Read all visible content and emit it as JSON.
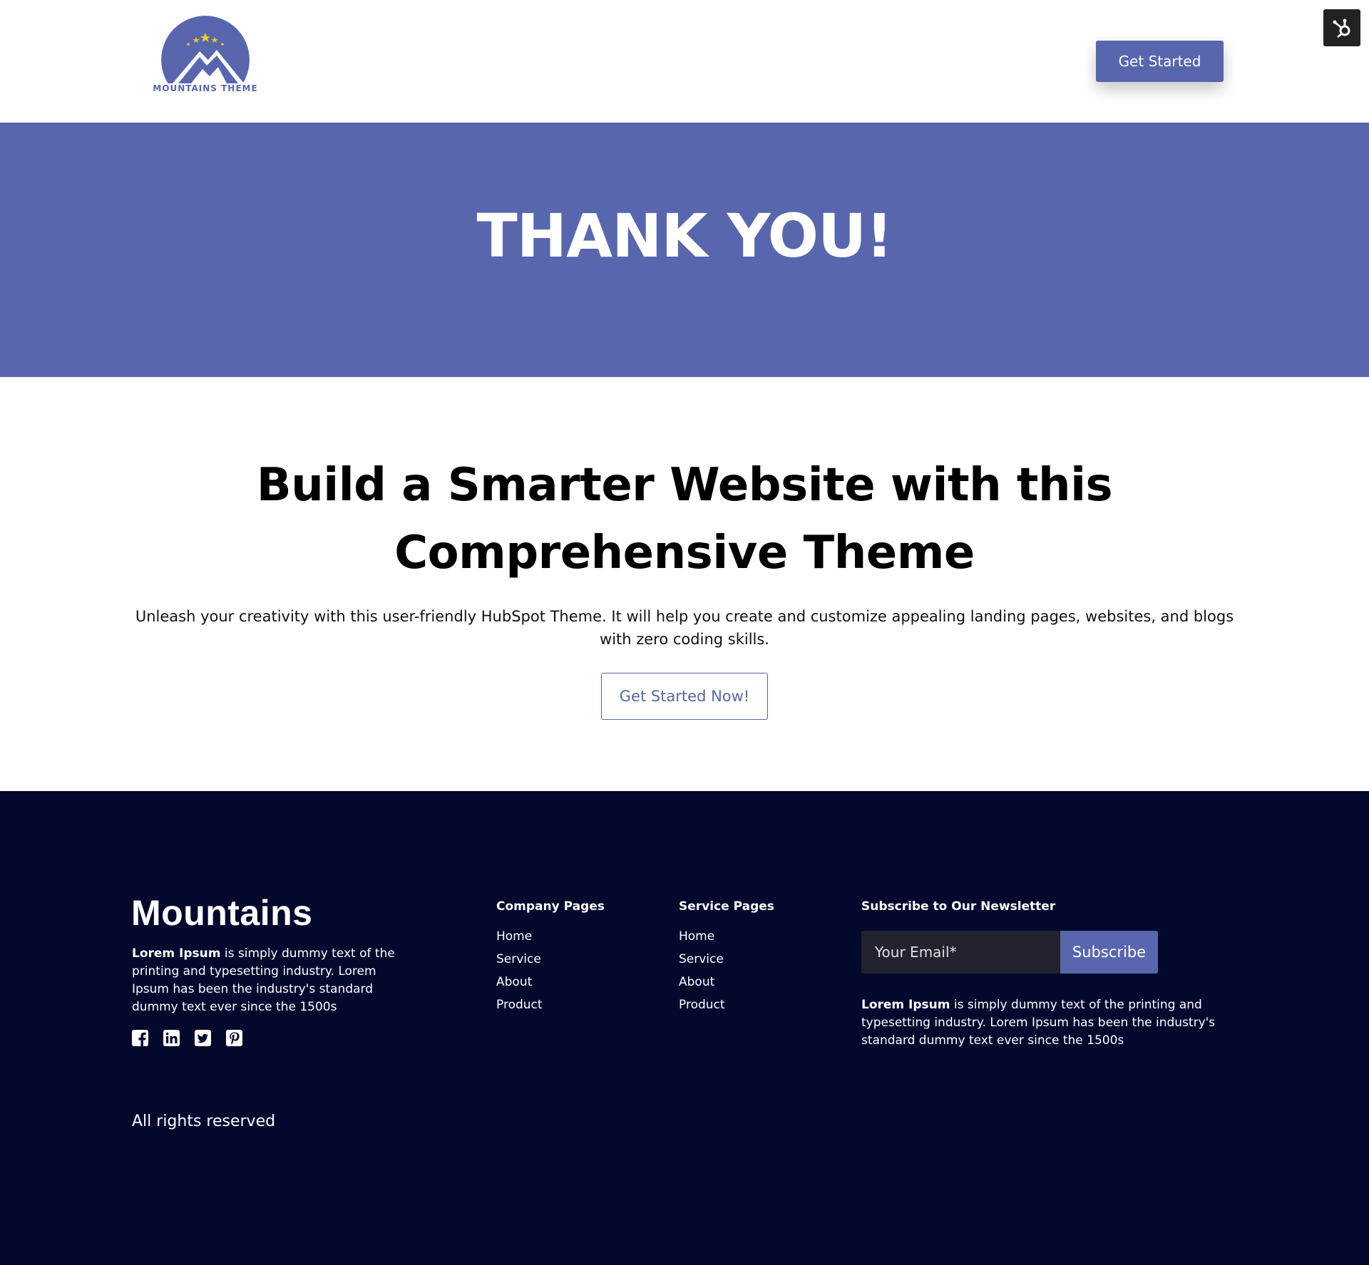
{
  "header": {
    "logo_text": "MOUNTAINS THEME",
    "cta_label": "Get Started"
  },
  "hero": {
    "title": "THANK YOU!"
  },
  "main": {
    "headline_line1": "Build a Smarter Website with this",
    "headline_line2": "Comprehensive Theme",
    "subtext": "Unleash your creativity with this user-friendly HubSpot Theme. It will help you create and customize appealing landing pages, websites, and blogs with zero coding skills.",
    "cta_label": "Get Started Now!"
  },
  "footer": {
    "brand": "Mountains",
    "desc_bold": "Lorem Ipsum",
    "desc_rest": " is simply dummy text of the printing and typesetting industry. Lorem Ipsum has been the industry's standard dummy text ever since the 1500s",
    "socials": [
      "facebook-icon",
      "linkedin-icon",
      "twitter-icon",
      "pinterest-icon"
    ],
    "company_pages": {
      "title": "Company Pages",
      "items": [
        "Home",
        "Service",
        "About",
        "Product"
      ]
    },
    "service_pages": {
      "title": "Service Pages",
      "items": [
        "Home",
        "Service",
        "About",
        "Product"
      ]
    },
    "newsletter": {
      "title": "Subscribe to Our Newsletter",
      "email_placeholder": "Your Email*",
      "subscribe_label": "Subscribe",
      "desc_bold": "Lorem Ipsum",
      "desc_rest": " is simply dummy text of the printing and typesetting industry. Lorem Ipsum has been the industry's standard dummy text ever since the 1500s"
    },
    "rights": "All rights reserved"
  },
  "colors": {
    "brand": "#5866ae",
    "footer_bg": "#03082d",
    "input_bg": "#22232e",
    "star": "#f3c623"
  }
}
